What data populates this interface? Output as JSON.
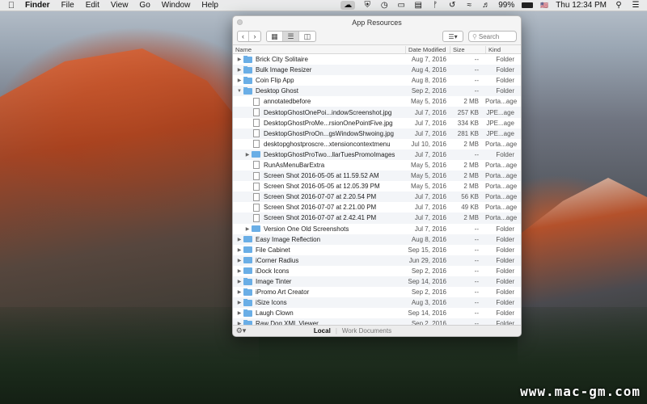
{
  "menubar": {
    "app_name": "Finder",
    "items": [
      "File",
      "Edit",
      "View",
      "Go",
      "Window",
      "Help"
    ],
    "status_icons": [
      "cloud-icon",
      "shield-icon",
      "clock-icon",
      "airplay-icon",
      "battery-menu-icon",
      "bluetooth-icon",
      "time-machine-icon",
      "wifi-icon",
      "volume-icon"
    ],
    "battery": "99%",
    "flag": "🇺🇸",
    "clock": "Thu 12:34 PM"
  },
  "window": {
    "title": "App Resources",
    "search_placeholder": "Search",
    "columns": {
      "name": "Name",
      "date": "Date Modified",
      "size": "Size",
      "kind": "Kind"
    },
    "rows": [
      {
        "tri": "▶",
        "indent": 0,
        "type": "folder",
        "name": "Brick City Solitaire",
        "date": "Aug 7, 2016",
        "size": "--",
        "kind": "Folder"
      },
      {
        "tri": "▶",
        "indent": 0,
        "type": "folder",
        "name": "Bulk Image Resizer",
        "date": "Aug 4, 2016",
        "size": "--",
        "kind": "Folder"
      },
      {
        "tri": "▶",
        "indent": 0,
        "type": "folder",
        "name": "Coin Flip App",
        "date": "Aug 8, 2016",
        "size": "--",
        "kind": "Folder"
      },
      {
        "tri": "▼",
        "indent": 0,
        "type": "folder",
        "name": "Desktop Ghost",
        "date": "Sep 2, 2016",
        "size": "--",
        "kind": "Folder"
      },
      {
        "tri": "",
        "indent": 1,
        "type": "file",
        "name": "annotatedbefore",
        "date": "May 5, 2016",
        "size": "2 MB",
        "kind": "Porta...age"
      },
      {
        "tri": "",
        "indent": 1,
        "type": "file",
        "name": "DesktopGhostOnePoi...indowScreenshot.jpg",
        "date": "Jul 7, 2016",
        "size": "257 KB",
        "kind": "JPE...age"
      },
      {
        "tri": "",
        "indent": 1,
        "type": "file",
        "name": "DesktopGhostProMe...rsionOnePointFive.jpg",
        "date": "Jul 7, 2016",
        "size": "334 KB",
        "kind": "JPE...age"
      },
      {
        "tri": "",
        "indent": 1,
        "type": "file",
        "name": "DesktopGhostProOn...gsWindowShwoing.jpg",
        "date": "Jul 7, 2016",
        "size": "281 KB",
        "kind": "JPE...age"
      },
      {
        "tri": "",
        "indent": 1,
        "type": "file",
        "name": "desktopghostproscre...xtensioncontextmenu",
        "date": "Jul 10, 2016",
        "size": "2 MB",
        "kind": "Porta...age"
      },
      {
        "tri": "▶",
        "indent": 1,
        "type": "folder",
        "name": "DesktopGhostProTwo...llarTuesPromoImages",
        "date": "Jul 7, 2016",
        "size": "--",
        "kind": "Folder"
      },
      {
        "tri": "",
        "indent": 1,
        "type": "file",
        "name": "RunAsMenuBarExtra",
        "date": "May 5, 2016",
        "size": "2 MB",
        "kind": "Porta...age"
      },
      {
        "tri": "",
        "indent": 1,
        "type": "file",
        "name": "Screen Shot 2016-05-05 at 11.59.52 AM",
        "date": "May 5, 2016",
        "size": "2 MB",
        "kind": "Porta...age"
      },
      {
        "tri": "",
        "indent": 1,
        "type": "file",
        "name": "Screen Shot 2016-05-05 at 12.05.39 PM",
        "date": "May 5, 2016",
        "size": "2 MB",
        "kind": "Porta...age"
      },
      {
        "tri": "",
        "indent": 1,
        "type": "file",
        "name": "Screen Shot 2016-07-07 at 2.20.54 PM",
        "date": "Jul 7, 2016",
        "size": "56 KB",
        "kind": "Porta...age"
      },
      {
        "tri": "",
        "indent": 1,
        "type": "file",
        "name": "Screen Shot 2016-07-07 at 2.21.00 PM",
        "date": "Jul 7, 2016",
        "size": "49 KB",
        "kind": "Porta...age"
      },
      {
        "tri": "",
        "indent": 1,
        "type": "file",
        "name": "Screen Shot 2016-07-07 at 2.42.41 PM",
        "date": "Jul 7, 2016",
        "size": "2 MB",
        "kind": "Porta...age"
      },
      {
        "tri": "▶",
        "indent": 1,
        "type": "folder",
        "name": "Version One Old Screenshots",
        "date": "Jul 7, 2016",
        "size": "--",
        "kind": "Folder"
      },
      {
        "tri": "▶",
        "indent": 0,
        "type": "folder",
        "name": "Easy Image Reflection",
        "date": "Aug 8, 2016",
        "size": "--",
        "kind": "Folder"
      },
      {
        "tri": "▶",
        "indent": 0,
        "type": "folder",
        "name": "File Cabinet",
        "date": "Sep 15, 2016",
        "size": "--",
        "kind": "Folder"
      },
      {
        "tri": "▶",
        "indent": 0,
        "type": "folder",
        "name": "iCorner Radius",
        "date": "Jun 29, 2016",
        "size": "--",
        "kind": "Folder"
      },
      {
        "tri": "▶",
        "indent": 0,
        "type": "folder",
        "name": "iDock Icons",
        "date": "Sep 2, 2016",
        "size": "--",
        "kind": "Folder"
      },
      {
        "tri": "▶",
        "indent": 0,
        "type": "folder",
        "name": "Image Tinter",
        "date": "Sep 14, 2016",
        "size": "--",
        "kind": "Folder"
      },
      {
        "tri": "▶",
        "indent": 0,
        "type": "folder",
        "name": "iPromo Art Creator",
        "date": "Sep 2, 2016",
        "size": "--",
        "kind": "Folder"
      },
      {
        "tri": "▶",
        "indent": 0,
        "type": "folder",
        "name": "iSize Icons",
        "date": "Aug 3, 2016",
        "size": "--",
        "kind": "Folder"
      },
      {
        "tri": "▶",
        "indent": 0,
        "type": "folder",
        "name": "Laugh Clown",
        "date": "Sep 14, 2016",
        "size": "--",
        "kind": "Folder"
      },
      {
        "tri": "▶",
        "indent": 0,
        "type": "folder",
        "name": "Raw Dog XML Viewer",
        "date": "Sep 2, 2016",
        "size": "--",
        "kind": "Folder"
      }
    ],
    "footer_tabs": [
      "Local",
      "Work Documents"
    ],
    "selected_tab": "Local"
  },
  "watermark": "www.mac-gm.com"
}
